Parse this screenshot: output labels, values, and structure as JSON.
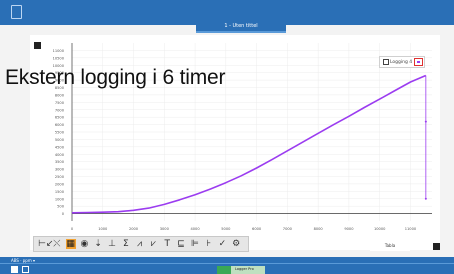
{
  "app": {
    "tab_title": "1 - Uten tittel",
    "overlay_title": "Ekstern logging i 6 timer"
  },
  "legend": {
    "label": "Logging 4"
  },
  "chart_data": {
    "type": "line",
    "title": "",
    "xlabel": "",
    "ylabel": "",
    "x_ticks": [
      "0",
      "1000",
      "2000",
      "3000",
      "4000",
      "5000",
      "6000",
      "7000",
      "8000",
      "9000",
      "10000",
      "11000"
    ],
    "y_ticks": [
      "0",
      "500",
      "1000",
      "1500",
      "2000",
      "2500",
      "3000",
      "3500",
      "4000",
      "4500",
      "5000",
      "5500",
      "6000",
      "6500",
      "7000",
      "7500",
      "8000",
      "8500",
      "9000",
      "9500",
      "10000",
      "10500",
      "11000"
    ],
    "xlim": [
      0,
      11700
    ],
    "ylim": [
      -500,
      11500
    ],
    "series": [
      {
        "color": "#9b3cf0",
        "x": [
          0,
          500,
          1000,
          1500,
          2000,
          2500,
          3000,
          3500,
          4000,
          4500,
          5000,
          5500,
          6000,
          6500,
          7000,
          7500,
          8000,
          8500,
          9000,
          9500,
          10000,
          10500,
          11000,
          11500
        ],
        "y": [
          50,
          70,
          90,
          130,
          220,
          370,
          620,
          930,
          1270,
          1660,
          2080,
          2550,
          3070,
          3640,
          4230,
          4820,
          5410,
          5990,
          6560,
          7150,
          7720,
          8300,
          8870,
          9310
        ]
      }
    ],
    "grid": true
  },
  "toolbar": {
    "tools": [
      "⊢↙",
      "⤬",
      "▦",
      "◉",
      "⇣",
      "⊥",
      "Σ",
      "⩘",
      "⩗",
      "T",
      "⊑",
      "⊫",
      "⊦",
      "✓",
      "⚙"
    ]
  },
  "right_button": {
    "label": "Tabla"
  },
  "status": {
    "text": "ABS · ppm ▾"
  },
  "taskbar": {
    "item_label": "Logger Pro"
  }
}
